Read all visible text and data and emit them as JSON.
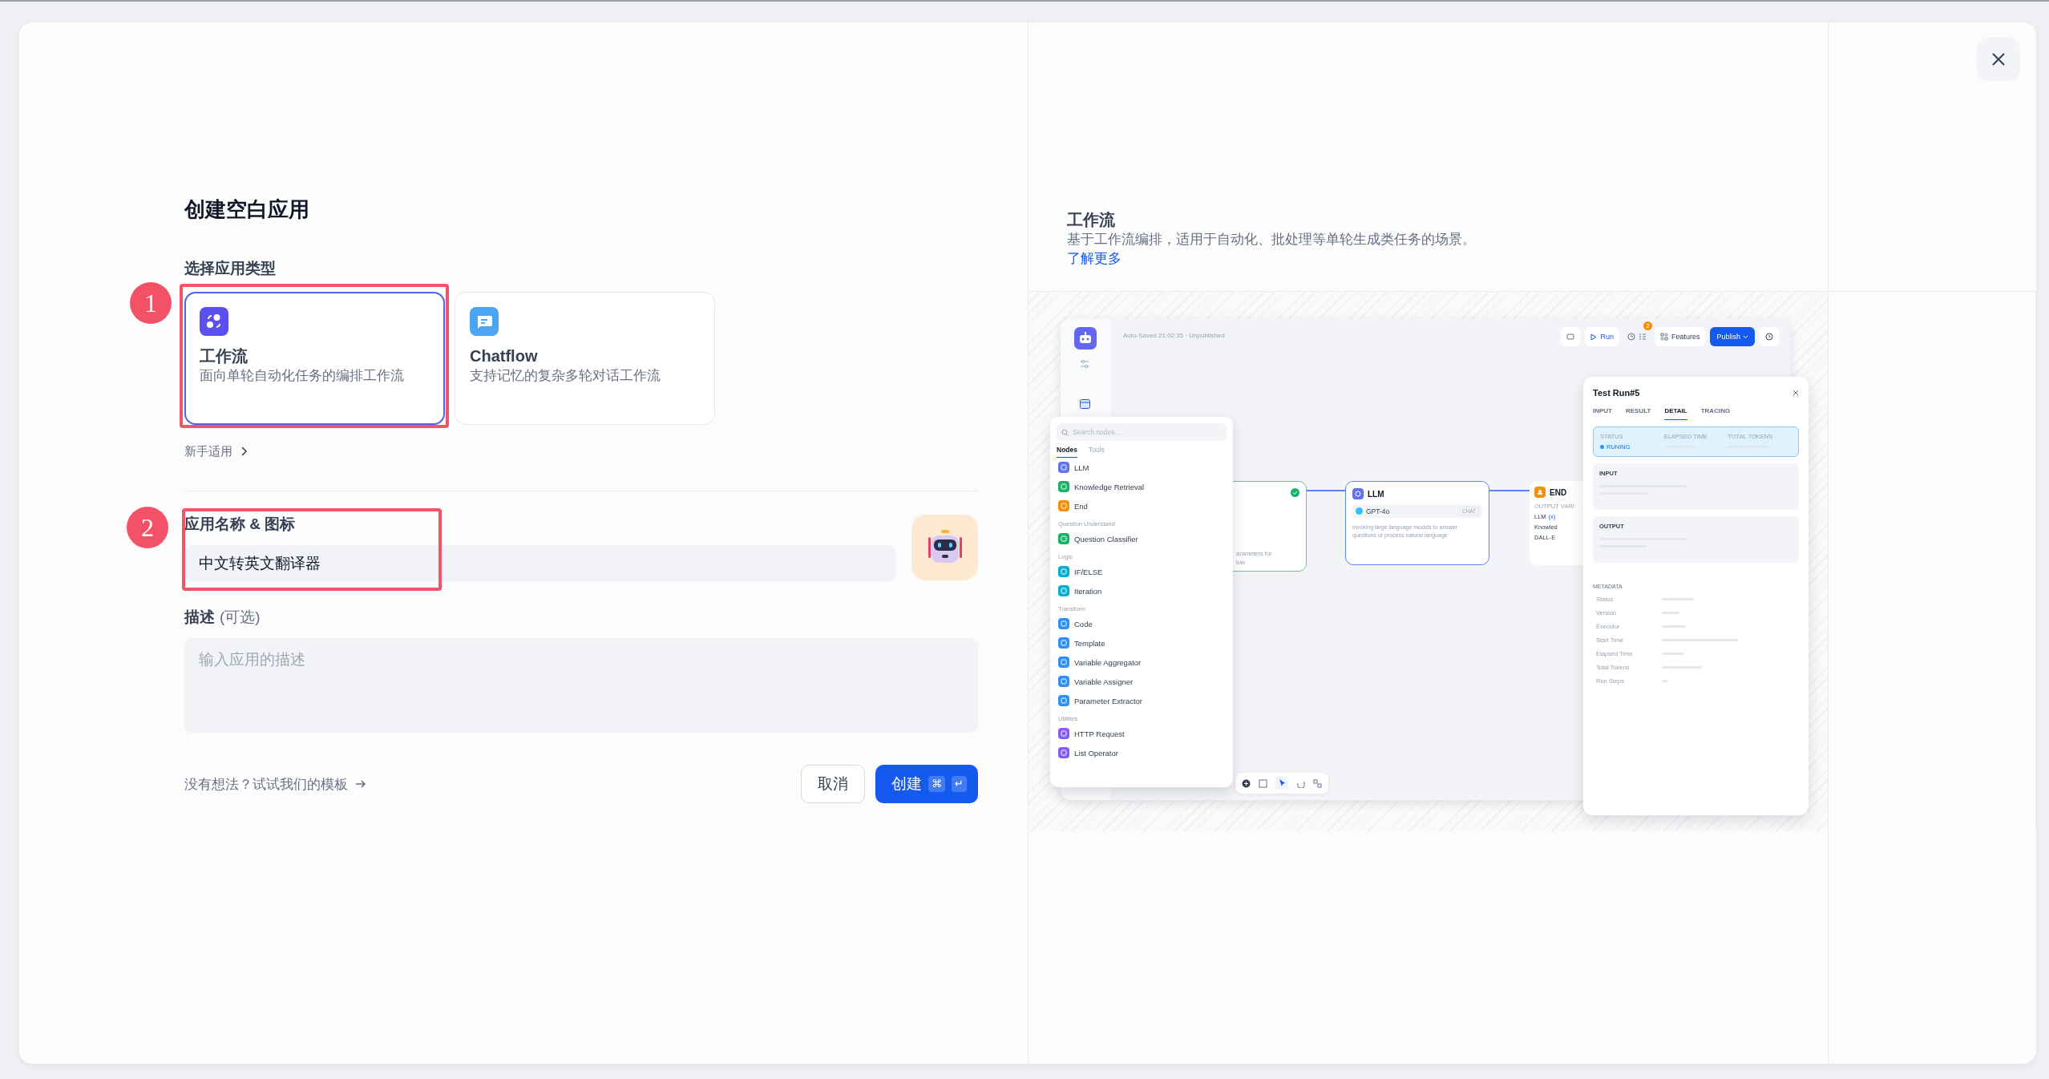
{
  "dialog": {
    "title": "创建空白应用"
  },
  "app_type": {
    "label": "选择应用类型",
    "options": [
      {
        "kind": "workflow",
        "title": "工作流",
        "description": "面向单轮自动化任务的编排工作流",
        "selected": true
      },
      {
        "kind": "chatflow",
        "title": "Chatflow",
        "description": "支持记忆的复杂多轮对话工作流",
        "selected": false
      }
    ],
    "beginner_link": "新手适用"
  },
  "markers": [
    "1",
    "2"
  ],
  "name_field": {
    "label": "应用名称 & 图标",
    "value": "中文转英文翻译器"
  },
  "description_field": {
    "label": "描述",
    "optional": "(可选)",
    "placeholder": "输入应用的描述"
  },
  "footer": {
    "template_link": "没有想法？试试我们的模板",
    "cancel": "取消",
    "create": "创建",
    "shortcut_keys": [
      "⌘",
      "↵"
    ]
  },
  "preview": {
    "title": "工作流",
    "description": "基于工作流编排，适用于自动化、批处理等单轮生成类任务的场景。",
    "learn_more": "了解更多",
    "screenshot": {
      "autosave": "Auto-Saved 21:02:35 · Unpublished",
      "run": "Run",
      "badge": "2",
      "features": "Features",
      "publish": "Publish",
      "palette": {
        "search_placeholder": "Search nodes...",
        "tabs": [
          {
            "label": "Nodes",
            "selected": true
          },
          {
            "label": "Tools",
            "selected": false
          }
        ],
        "groups": [
          {
            "items": [
              {
                "label": "LLM",
                "color": "#6172f3"
              },
              {
                "label": "Knowledge Retrieval",
                "color": "#16b364"
              },
              {
                "label": "End",
                "color": "#f79009"
              }
            ]
          },
          {
            "title": "Question Understand",
            "items": [
              {
                "label": "Question Classifier",
                "color": "#16b364"
              }
            ]
          },
          {
            "title": "Logic",
            "items": [
              {
                "label": "IF/ELSE",
                "color": "#06aed4"
              },
              {
                "label": "Iteration",
                "color": "#06aed4"
              }
            ]
          },
          {
            "title": "Transform",
            "items": [
              {
                "label": "Code",
                "color": "#2e90fa"
              },
              {
                "label": "Template",
                "color": "#2e90fa"
              },
              {
                "label": "Variable Aggregator",
                "color": "#2e90fa"
              },
              {
                "label": "Variable Assigner",
                "color": "#2e90fa"
              },
              {
                "label": "Parameter Extractor",
                "color": "#2e90fa"
              }
            ]
          },
          {
            "title": "Utilities",
            "items": [
              {
                "label": "HTTP Request",
                "color": "#875bf7"
              },
              {
                "label": "List Operator",
                "color": "#875bf7"
              }
            ]
          }
        ]
      },
      "start_node": {
        "lines": [
          "arameters for",
          "low"
        ]
      },
      "llm_node": {
        "title": "LLM",
        "model": "GPT-4o",
        "mode": "CHAT",
        "description": "Invoking large language models to answer questions or process natural language"
      },
      "end_node": {
        "title": "END",
        "output_label": "OUTPUT VARI",
        "outputs": [
          "LLM",
          "Knowled",
          "DALL-E"
        ],
        "variable_mark": "(x)"
      },
      "test_run": {
        "title": "Test Run#5",
        "tabs": [
          {
            "label": "INPUT",
            "selected": false
          },
          {
            "label": "RESULT",
            "selected": false
          },
          {
            "label": "DETAIL",
            "selected": true
          },
          {
            "label": "TRACING",
            "selected": false
          }
        ],
        "status_label": "STATUS",
        "status": "RUNING",
        "elapsed_label": "ELAPSED TIME",
        "tokens_label": "TOTAL TOKENS",
        "input_label": "INPUT",
        "output_label": "OUTPUT",
        "metadata_title": "METADATA",
        "metadata": [
          "Status",
          "Version",
          "Executor",
          "Start Time",
          "Elapsed Time",
          "Total Tokens",
          "Run Steps"
        ]
      }
    }
  }
}
